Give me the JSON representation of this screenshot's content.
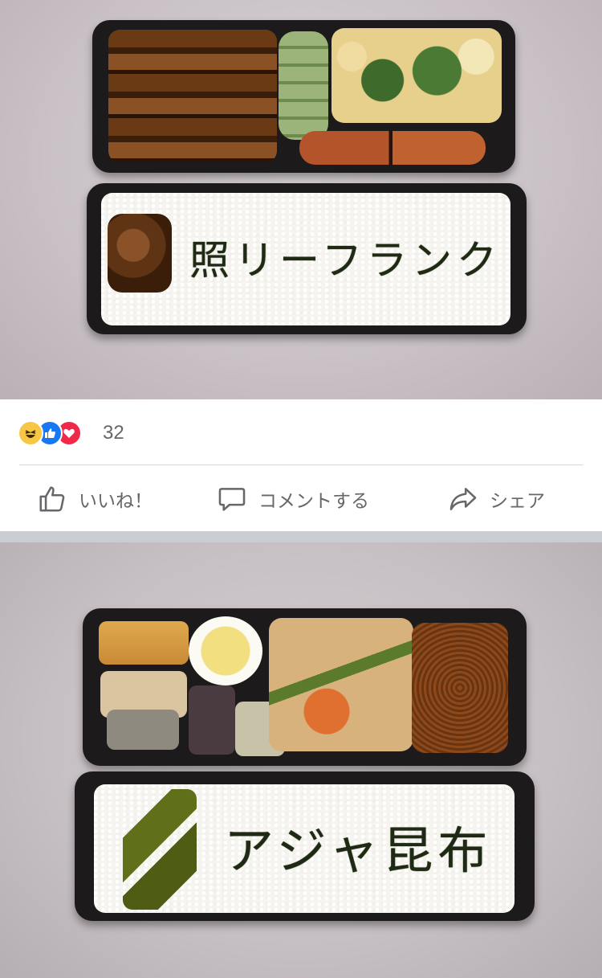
{
  "post1": {
    "rice_text": "照リーフランク"
  },
  "reactions": {
    "icons": [
      "haha-icon",
      "like-icon",
      "love-icon"
    ],
    "count": "32"
  },
  "actions": {
    "like_label": "いいね！",
    "comment_label": "コメントする",
    "share_label": "シェア"
  },
  "post2": {
    "rice_text": "アジャ昆布"
  },
  "colors": {
    "haha": "#f7c744",
    "like": "#1877f2",
    "love": "#f0284a",
    "text_secondary": "#65676b"
  }
}
